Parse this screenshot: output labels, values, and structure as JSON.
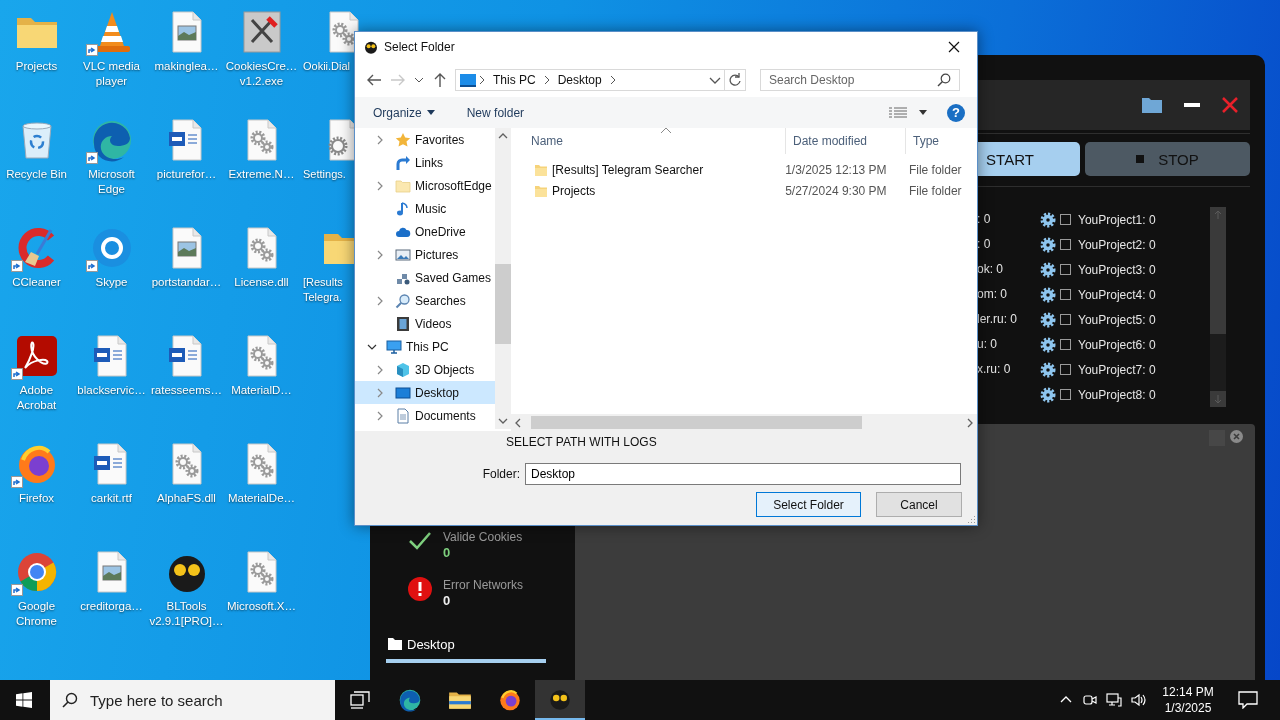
{
  "desktop": {
    "columns": [
      [
        {
          "label": "Projects",
          "kind": "folder",
          "shortcut": false
        },
        {
          "label": "Recycle Bin",
          "kind": "recycle",
          "shortcut": false
        },
        {
          "label": "CCleaner",
          "kind": "ccleaner",
          "shortcut": true
        },
        {
          "label": "Adobe Acrobat",
          "kind": "acrobat",
          "shortcut": true
        },
        {
          "label": "Firefox",
          "kind": "firefox",
          "shortcut": true
        },
        {
          "label": "Google Chrome",
          "kind": "chrome",
          "shortcut": true
        }
      ],
      [
        {
          "label": "VLC media player",
          "kind": "cone",
          "shortcut": true
        },
        {
          "label": "Microsoft Edge",
          "kind": "edge",
          "shortcut": true
        },
        {
          "label": "Skype",
          "kind": "skype",
          "shortcut": true
        },
        {
          "label": "blackservic…",
          "kind": "word",
          "shortcut": false
        },
        {
          "label": "carkit.rtf",
          "kind": "word",
          "shortcut": false
        },
        {
          "label": "creditorga…",
          "kind": "image",
          "shortcut": false
        }
      ],
      [
        {
          "label": "makinglea…",
          "kind": "image",
          "shortcut": false
        },
        {
          "label": "picturefor…",
          "kind": "word",
          "shortcut": false
        },
        {
          "label": "portstandar…",
          "kind": "image",
          "shortcut": false
        },
        {
          "label": "ratesseems…",
          "kind": "word",
          "shortcut": false
        },
        {
          "label": "AlphaFS.dll",
          "kind": "gears",
          "shortcut": false
        },
        {
          "label": "BLTools v2.9.1[PRO]…",
          "kind": "bltools",
          "shortcut": false
        }
      ],
      [
        {
          "label": "CookiesCre… v1.2.exe",
          "kind": "tools",
          "shortcut": false
        },
        {
          "label": "Extreme.N…",
          "kind": "gears",
          "shortcut": false
        },
        {
          "label": "License.dll",
          "kind": "gears",
          "shortcut": false
        },
        {
          "label": "MaterialD…",
          "kind": "gears",
          "shortcut": false
        },
        {
          "label": "MaterialDe…",
          "kind": "gears",
          "shortcut": false
        },
        {
          "label": "Microsoft.X…",
          "kind": "gears",
          "shortcut": false
        }
      ],
      [
        {
          "label": "Ookii.Dial",
          "kind": "gears",
          "shortcut": false
        },
        {
          "label": "Settings.",
          "kind": "gear",
          "shortcut": false
        },
        {
          "label": "[Results Telegra.",
          "kind": "folder",
          "shortcut": false
        }
      ]
    ]
  },
  "app": {
    "buttons": [
      {
        "label": "START",
        "kind": "start"
      },
      {
        "label": "STOP",
        "kind": "stop"
      }
    ],
    "stats": [
      ": 0",
      ": 0",
      "ok: 0",
      "om: 0",
      "ler.ru: 0",
      "u: 0",
      "x.ru: 0"
    ],
    "projects": [
      {
        "label": "YouProject1: 0",
        "checked": false
      },
      {
        "label": "YouProject2: 0",
        "checked": false
      },
      {
        "label": "YouProject3: 0",
        "checked": false
      },
      {
        "label": "YouProject4: 0",
        "checked": false
      },
      {
        "label": "YouProject5: 0",
        "checked": false
      },
      {
        "label": "YouProject6: 0",
        "checked": false
      },
      {
        "label": "YouProject7: 0",
        "checked": false
      },
      {
        "label": "YouProject8: 0",
        "checked": false
      }
    ],
    "counters": [
      {
        "label": "Valide Cookies",
        "value": "0",
        "kind": "ok"
      },
      {
        "label": "Error Networks",
        "value": "0",
        "kind": "error"
      }
    ],
    "path": {
      "label": "Desktop",
      "level": 1
    }
  },
  "dialog": {
    "title": "Select Folder",
    "breadcrumb": [
      "This PC",
      "Desktop"
    ],
    "search": {
      "placeholder": "Search Desktop"
    },
    "toolbar": [
      {
        "label": "Organize",
        "kind": "menu"
      },
      {
        "label": "New folder",
        "kind": "button"
      }
    ],
    "help": "?",
    "tree": [
      {
        "children": [
          {
            "label": "Favorites",
            "kind": "star",
            "expanded": false,
            "selected": false
          },
          {
            "label": "Links",
            "kind": "link",
            "selected": false
          },
          {
            "label": "MicrosoftEdge",
            "kind": "folder",
            "expanded": false,
            "selected": false
          },
          {
            "label": "Music",
            "kind": "music",
            "selected": false
          },
          {
            "label": "OneDrive",
            "kind": "cloud",
            "selected": false
          },
          {
            "label": "Pictures",
            "kind": "pictures",
            "expanded": false,
            "selected": false
          },
          {
            "label": "Saved Games",
            "kind": "games",
            "selected": false
          },
          {
            "label": "Searches",
            "kind": "search",
            "expanded": false,
            "selected": false
          },
          {
            "label": "Videos",
            "kind": "videos",
            "selected": false
          }
        ]
      },
      {
        "label": "This PC",
        "kind": "pc",
        "expanded": true,
        "selected": false,
        "children": [
          {
            "label": "3D Objects",
            "kind": "cube",
            "expanded": false,
            "selected": false
          },
          {
            "label": "Desktop",
            "kind": "desktop",
            "expanded": false,
            "selected": true
          },
          {
            "label": "Documents",
            "kind": "documents",
            "expanded": false,
            "selected": false
          }
        ]
      }
    ],
    "columns": [
      "Name",
      "Date modified",
      "Type"
    ],
    "files": [
      {
        "name": "[Results] Telegram Searcher",
        "date": "1/3/2025 12:13 PM",
        "type": "File folder",
        "selected": false
      },
      {
        "name": "Projects",
        "date": "5/27/2024 9:30 PM",
        "type": "File folder",
        "selected": false
      }
    ],
    "hint": "SELECT PATH WITH LOGS",
    "folder": {
      "label": "Folder:",
      "value": "Desktop"
    },
    "buttons": [
      {
        "label": "Select Folder",
        "default": true
      },
      {
        "label": "Cancel",
        "default": false
      }
    ]
  },
  "taskbar": {
    "search": {
      "placeholder": "Type here to search"
    },
    "apps": [
      {
        "kind": "edge",
        "active": false
      },
      {
        "kind": "explorer",
        "active": false
      },
      {
        "kind": "firefox",
        "active": false
      },
      {
        "kind": "bltools",
        "active": true
      }
    ],
    "time": "12:14 PM",
    "date": "1/3/2025"
  }
}
